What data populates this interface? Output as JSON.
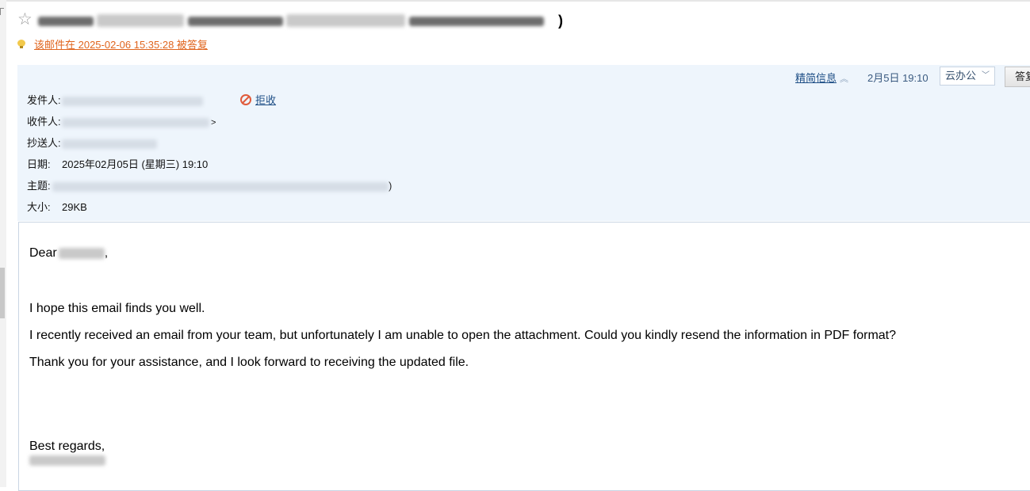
{
  "subject_line": {
    "end_char": ")"
  },
  "reply_note": {
    "text": "该邮件在 2025-02-06 15:35:28 被答复"
  },
  "toolbar": {
    "brief_info_label": "精简信息",
    "datetime": "2月5日 19:10",
    "cloud_office_label": "云办公",
    "reply_label": "答复"
  },
  "header": {
    "from_label": "发件人:",
    "reject_label": "拒收",
    "to_label": "收件人:",
    "to_suffix": ">",
    "cc_label": "抄送人:",
    "date_label": "日期:",
    "date_value": "2025年02月05日 (星期三) 19:10",
    "subject_label": "主题:",
    "subject_suffix": ")",
    "size_label": "大小:",
    "size_value": "29KB"
  },
  "email_body": {
    "greeting": "Dear",
    "greeting_suffix": ",",
    "line1": "I hope this email finds you well.",
    "line2": "I recently received an email from your team, but unfortunately I am unable to open the attachment. Could you kindly resend the information in PDF format?",
    "line3": "Thank you for your assistance, and I look forward to receiving the updated file.",
    "closing": "Best regards,"
  },
  "icons": {
    "star": "star-icon",
    "bulb": "lightbulb-icon",
    "reject": "reject-icon",
    "chevron_up": "chevron-up-icon",
    "chevron_down": "chevron-down-icon"
  },
  "colors": {
    "header_bg": "#eef5fc",
    "link_blue": "#1f4f86",
    "notice_orange": "#e0651e",
    "reject_red": "#e05a3a"
  }
}
